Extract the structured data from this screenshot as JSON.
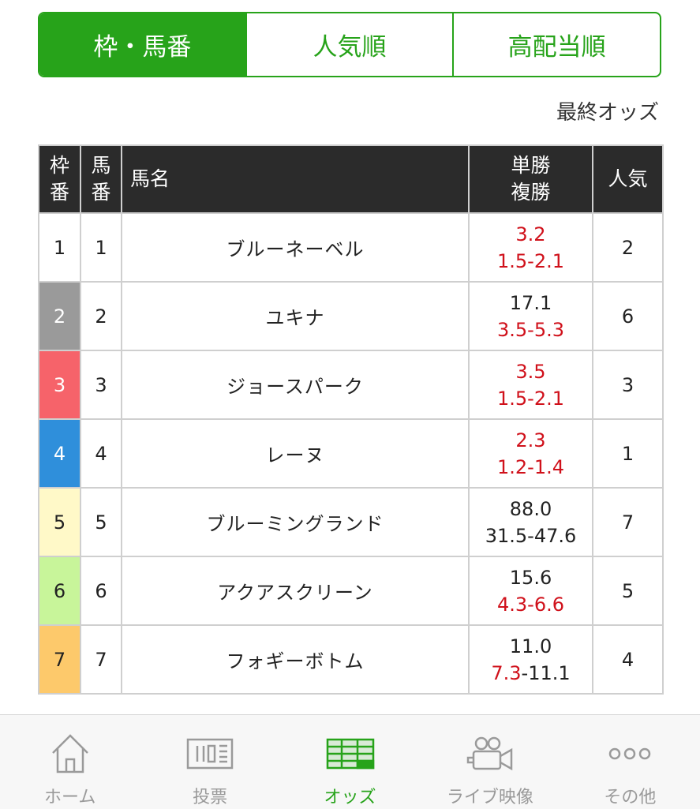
{
  "tabs": [
    {
      "label": "枠・馬番",
      "active": true
    },
    {
      "label": "人気順",
      "active": false
    },
    {
      "label": "高配当順",
      "active": false
    }
  ],
  "odds_caption": "最終オッズ",
  "table": {
    "headers": {
      "waku": [
        "枠",
        "番"
      ],
      "umaban": [
        "馬",
        "番"
      ],
      "name": "馬名",
      "odds": [
        "単勝",
        "複勝"
      ],
      "popularity": "人気"
    },
    "rows": [
      {
        "waku": "1",
        "umaban": "1",
        "name": "ブルーネーベル",
        "win": "3.2",
        "place_lo": "1.5",
        "place_hi": "2.1",
        "pop": "2",
        "frame_color": "#ffffff",
        "waku_text_color": "#222222",
        "win_red": true,
        "place_lo_red": true,
        "place_hi_red": true
      },
      {
        "waku": "2",
        "umaban": "2",
        "name": "ユキナ",
        "win": "17.1",
        "place_lo": "3.5",
        "place_hi": "5.3",
        "pop": "6",
        "frame_color": "#9a9a9a",
        "waku_text_color": "#ffffff",
        "win_red": false,
        "place_lo_red": true,
        "place_hi_red": true
      },
      {
        "waku": "3",
        "umaban": "3",
        "name": "ジョースパーク",
        "win": "3.5",
        "place_lo": "1.5",
        "place_hi": "2.1",
        "pop": "3",
        "frame_color": "#f6636a",
        "waku_text_color": "#ffffff",
        "win_red": true,
        "place_lo_red": true,
        "place_hi_red": true
      },
      {
        "waku": "4",
        "umaban": "4",
        "name": "レーヌ",
        "win": "2.3",
        "place_lo": "1.2",
        "place_hi": "1.4",
        "pop": "1",
        "frame_color": "#2f8fdb",
        "waku_text_color": "#ffffff",
        "win_red": true,
        "place_lo_red": true,
        "place_hi_red": true
      },
      {
        "waku": "5",
        "umaban": "5",
        "name": "ブルーミングランド",
        "win": "88.0",
        "place_lo": "31.5",
        "place_hi": "47.6",
        "pop": "7",
        "frame_color": "#fff9c8",
        "waku_text_color": "#222222",
        "win_red": false,
        "place_lo_red": false,
        "place_hi_red": false
      },
      {
        "waku": "6",
        "umaban": "6",
        "name": "アクアスクリーン",
        "win": "15.6",
        "place_lo": "4.3",
        "place_hi": "6.6",
        "pop": "5",
        "frame_color": "#c8f59a",
        "waku_text_color": "#222222",
        "win_red": false,
        "place_lo_red": true,
        "place_hi_red": true
      },
      {
        "waku": "7",
        "umaban": "7",
        "name": "フォギーボトム",
        "win": "11.0",
        "place_lo": "7.3",
        "place_hi": "11.1",
        "pop": "4",
        "frame_color": "#fdc96b",
        "waku_text_color": "#222222",
        "win_red": false,
        "place_lo_red": true,
        "place_hi_red": false
      }
    ]
  },
  "nav": [
    {
      "label": "ホーム",
      "icon": "home-icon",
      "active": false
    },
    {
      "label": "投票",
      "icon": "ticket-icon",
      "active": false
    },
    {
      "label": "オッズ",
      "icon": "odds-table-icon",
      "active": true
    },
    {
      "label": "ライブ映像",
      "icon": "video-camera-icon",
      "active": false
    },
    {
      "label": "その他",
      "icon": "more-icon",
      "active": false
    }
  ],
  "colors": {
    "accent": "#27a31a",
    "odds_red": "#d0111b",
    "header_bg": "#2b2b2b"
  }
}
